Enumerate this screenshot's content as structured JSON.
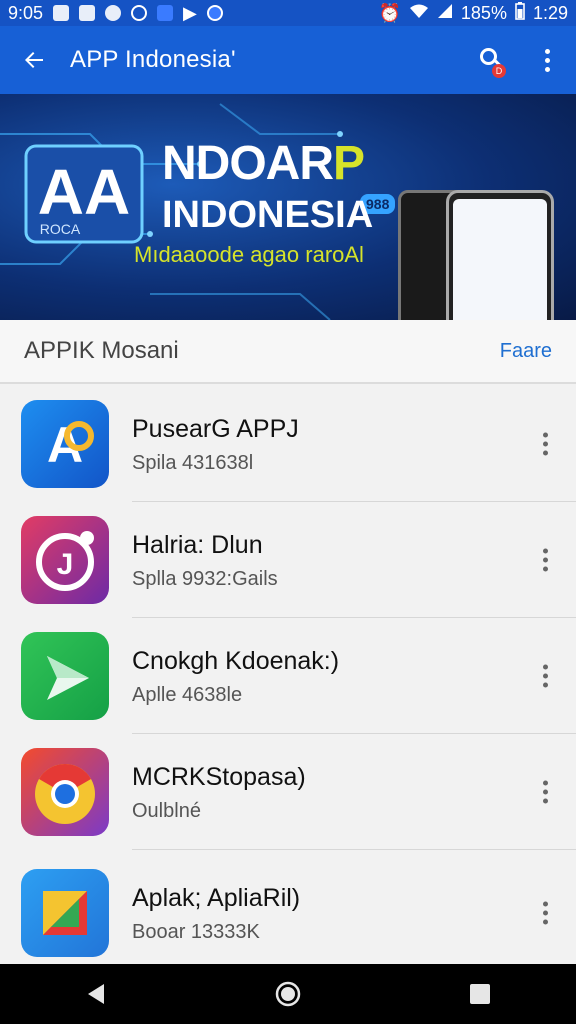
{
  "status_bar": {
    "time_left": "9:05",
    "battery": "185%",
    "time_right": "1:29"
  },
  "app_bar": {
    "title": "APP Indonesia'",
    "search_badge": "D",
    "icons": [
      "back-arrow-icon",
      "search-icon",
      "overflow-menu-icon"
    ]
  },
  "banner": {
    "logo_text": "AA",
    "logo_sub": "ROCA",
    "badge": "988",
    "title_main": "NDOAR",
    "title_p": "P",
    "subtitle": "INDONESIA",
    "tagline": "Mıdaaoode agao raroAl"
  },
  "section": {
    "title": "APPIK Mosani",
    "action": "Faare"
  },
  "apps": [
    {
      "name": "PusearG APPJ",
      "meta": "Spila 431638l",
      "icon_colors": [
        "#1e8ef0",
        "#1255c8"
      ],
      "icon": "blue-a-logo-icon"
    },
    {
      "name": "Halria: Dlun",
      "meta": "Splla 9932:Gails",
      "icon_colors": [
        "#e23c64",
        "#6d2aa6"
      ],
      "icon": "j-circle-logo-icon"
    },
    {
      "name": "Cnokgh Kdoenak:)",
      "meta": "Aplle 4638le",
      "icon_colors": [
        "#31c457",
        "#15a046"
      ],
      "icon": "send-arrow-icon"
    },
    {
      "name": "MCRKStopasa)",
      "meta": "Oulblné",
      "icon_colors": [
        "#f44b2c",
        "#7b3ac8"
      ],
      "icon": "chrome-like-icon"
    },
    {
      "name": "Aplak; ApliaRil)",
      "meta": "Booar 13333K",
      "icon_colors": [
        "#2d9ff2",
        "#2275d8"
      ],
      "icon": "colorful-triangle-icon"
    }
  ],
  "nav_bar": {
    "icons": [
      "back-triangle-icon",
      "home-circle-icon",
      "recents-square-icon"
    ]
  },
  "colors": {
    "primary": "#1760d6",
    "status_bar": "#1553c4",
    "accent": "#1f6fd1"
  }
}
